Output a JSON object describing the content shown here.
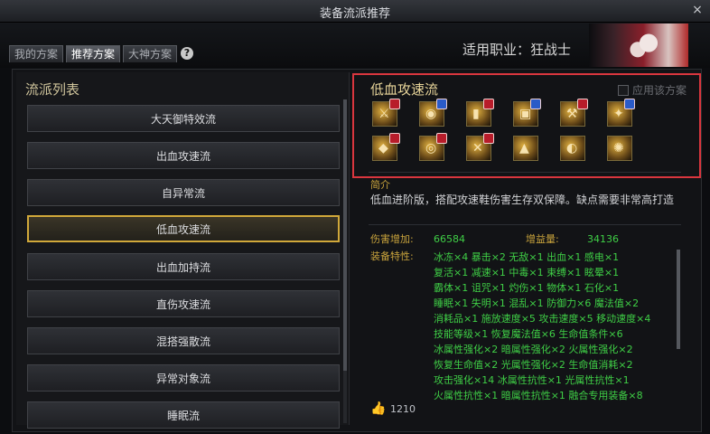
{
  "window": {
    "title": "装备流派推荐"
  },
  "tabs": [
    {
      "label": "我的方案"
    },
    {
      "label": "推荐方案"
    },
    {
      "label": "大神方案"
    }
  ],
  "job": {
    "label": "适用职业：狂战士"
  },
  "list": {
    "title": "流派列表",
    "items": [
      {
        "label": "大天御特效流"
      },
      {
        "label": "出血攻速流"
      },
      {
        "label": "自异常流"
      },
      {
        "label": "低血攻速流"
      },
      {
        "label": "出血加持流"
      },
      {
        "label": "直伤攻速流"
      },
      {
        "label": "混搭强散流"
      },
      {
        "label": "异常对象流"
      },
      {
        "label": "睡眠流"
      }
    ],
    "selected": "低血攻速流"
  },
  "scheme": {
    "title": "低血攻速流",
    "apply_label": "应用该方案",
    "equipment_icons": [
      "weapon-icon",
      "wand-icon",
      "coat-icon",
      "shoulder-icon",
      "belt-icon",
      "pants-icon",
      "bracelet-icon",
      "necklace-icon",
      "ring-icon",
      "shoes-icon",
      "earring-icon",
      "magic-stone-icon"
    ]
  },
  "intro": {
    "label": "简介",
    "text": "低血进阶版，搭配攻速鞋伤害生存双保障。缺点需要非常高打造"
  },
  "stats": {
    "damage_label": "伤害增加:",
    "damage_value": "66584",
    "gain_label": "增益量:",
    "gain_value": "34136",
    "traits_label": "装备特性:",
    "traits": [
      "冰冻×4   暴击×2   无敌×1   出血×1   感电×1",
      "复活×1   减速×1   中毒×1   束缚×1   眩晕×1",
      "霸体×1   诅咒×1   灼伤×1   物体×1   石化×1",
      "睡眠×1   失明×1   混乱×1   防御力×6   魔法值×2",
      "消耗品×1   施放速度×5   攻击速度×5   移动速度×4",
      "技能等级×1   恢复魔法值×6   生命值条件×6",
      "冰属性强化×2   暗属性强化×2   火属性强化×2",
      "恢复生命值×2   光属性强化×2   生命值消耗×2",
      "攻击强化×14   冰属性抗性×1   光属性抗性×1",
      "火属性抗性×1   暗属性抗性×1   融合专用装备×8"
    ]
  },
  "likes": {
    "count": "1210"
  },
  "help": {
    "symbol": "?"
  },
  "close": {
    "symbol": "×"
  }
}
